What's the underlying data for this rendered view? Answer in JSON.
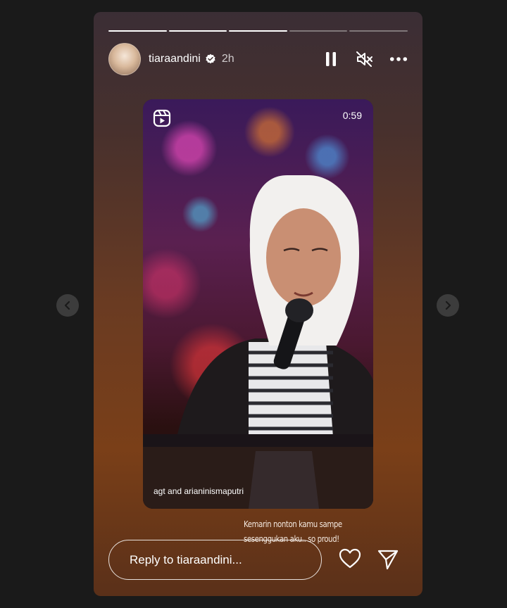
{
  "header": {
    "username": "tiaraandini",
    "time": "2h",
    "progress_segments": [
      1,
      1,
      1,
      0,
      0
    ]
  },
  "media": {
    "duration": "0:59",
    "credit": "agt and arianinismaputri"
  },
  "caption": {
    "line1": "Kemarin nonton kamu sampe",
    "line2": "sesenggukan aku.. so proud!"
  },
  "reply": {
    "placeholder": "Reply to tiaraandini..."
  },
  "icons": {
    "pause": "pause-icon",
    "mute": "mute-icon",
    "more": "more-icon",
    "like": "heart-icon",
    "share": "send-icon",
    "prev": "chevron-left-icon",
    "next": "chevron-right-icon",
    "reels": "reels-icon",
    "verified": "verified-badge-icon"
  },
  "colors": {
    "page_bg": "#1a1a1a",
    "text": "#ffffff",
    "verified": "#ffffff"
  }
}
